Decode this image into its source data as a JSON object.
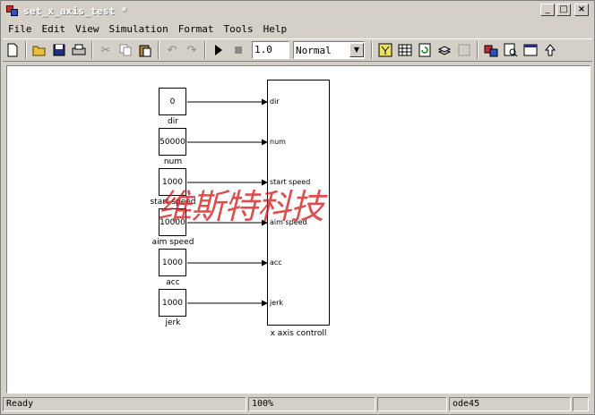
{
  "window": {
    "title": "set_x_axis_test *",
    "minimize_label": "_",
    "maximize_label": "□",
    "close_label": "×"
  },
  "menu": [
    "File",
    "Edit",
    "View",
    "Simulation",
    "Format",
    "Tools",
    "Help"
  ],
  "toolbar": {
    "stop_time": "1.0",
    "sim_mode": "Normal"
  },
  "icons": [
    "new-icon",
    "open-icon",
    "save-icon",
    "print-icon",
    "cut-icon",
    "copy-icon",
    "paste-icon",
    "undo-icon",
    "redo-icon",
    "play-icon",
    "stop-icon",
    "build-icon",
    "debug-icon",
    "update-icon",
    "library-icon",
    "model-explorer-icon",
    "subsystem-icon",
    "explorer-icon",
    "up-icon"
  ],
  "diagram": {
    "constants": [
      {
        "value": "0",
        "label": "dir"
      },
      {
        "value": "50000",
        "label": "num"
      },
      {
        "value": "1000",
        "label": "start speed"
      },
      {
        "value": "10000",
        "label": "aim speed"
      },
      {
        "value": "1000",
        "label": "acc"
      },
      {
        "value": "1000",
        "label": "jerk"
      }
    ],
    "subsystem": {
      "label": "x axis controll",
      "ports": [
        "dir",
        "num",
        "start speed",
        "aim speed",
        "acc",
        "jerk"
      ]
    },
    "watermark": "维斯特科技"
  },
  "status": {
    "state": "Ready",
    "zoom": "100%",
    "cell3": "",
    "solver": "ode45",
    "cell5": ""
  },
  "colors": {
    "watermark": "#d21e1e",
    "titlebar_text": "#ffffff"
  }
}
